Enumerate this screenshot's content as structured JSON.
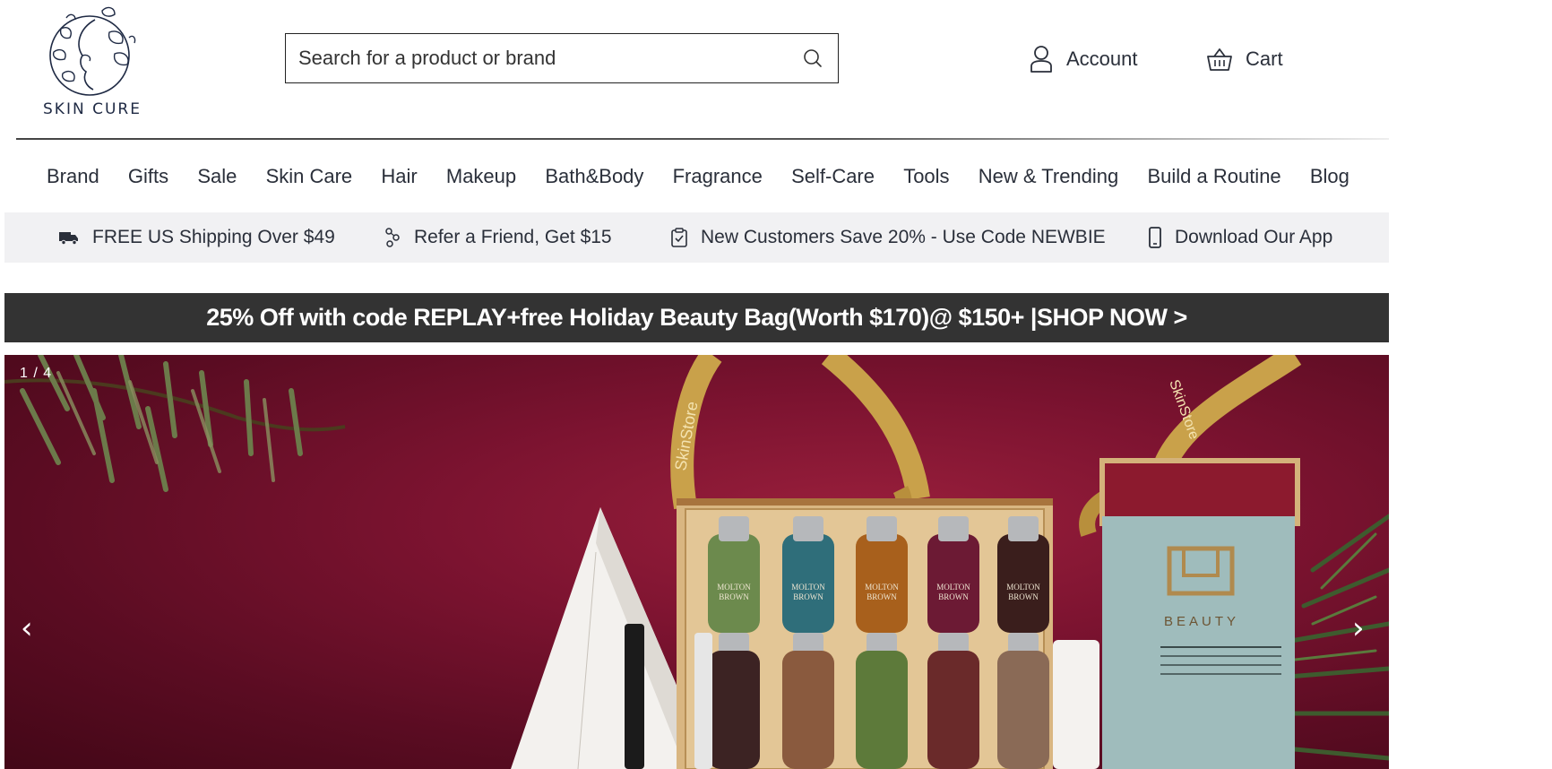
{
  "brand": {
    "logo_text": "SKIN CURE"
  },
  "search": {
    "placeholder": "Search for a product or brand"
  },
  "header": {
    "account_label": "Account",
    "cart_label": "Cart"
  },
  "nav": {
    "items": [
      "Brand",
      "Gifts",
      "Sale",
      "Skin Care",
      "Hair",
      "Makeup",
      "Bath&Body",
      "Fragrance",
      "Self-Care",
      "Tools",
      "New & Trending",
      "Build a Routine",
      "Blog"
    ]
  },
  "promos": [
    {
      "label": "FREE US Shipping Over $49",
      "icon": "truck-icon"
    },
    {
      "label": "Refer a Friend, Get $15",
      "icon": "refer-icon"
    },
    {
      "label": "New Customers Save 20% - Use Code NEWBIE",
      "icon": "clipboard-check-icon"
    },
    {
      "label": "Download Our App",
      "icon": "phone-icon"
    }
  ],
  "banner": {
    "text": "25% Off with code REPLAY+free Holiday Beauty Bag(Worth $170)@ $150+ |SHOP NOW >"
  },
  "hero": {
    "counter": "1 / 4",
    "prev_glyph": "‹",
    "next_glyph": "›",
    "bottle_label_lines": [
      "MOLTON",
      "BROWN"
    ],
    "box_label": "BEAUTY",
    "ribbon_text": "SkinStore"
  },
  "colors": {
    "banner_bg": "#333333",
    "promo_bg": "#f1f1f3",
    "hero_bg": "#7c1330",
    "ribbon": "#c9a14a"
  }
}
